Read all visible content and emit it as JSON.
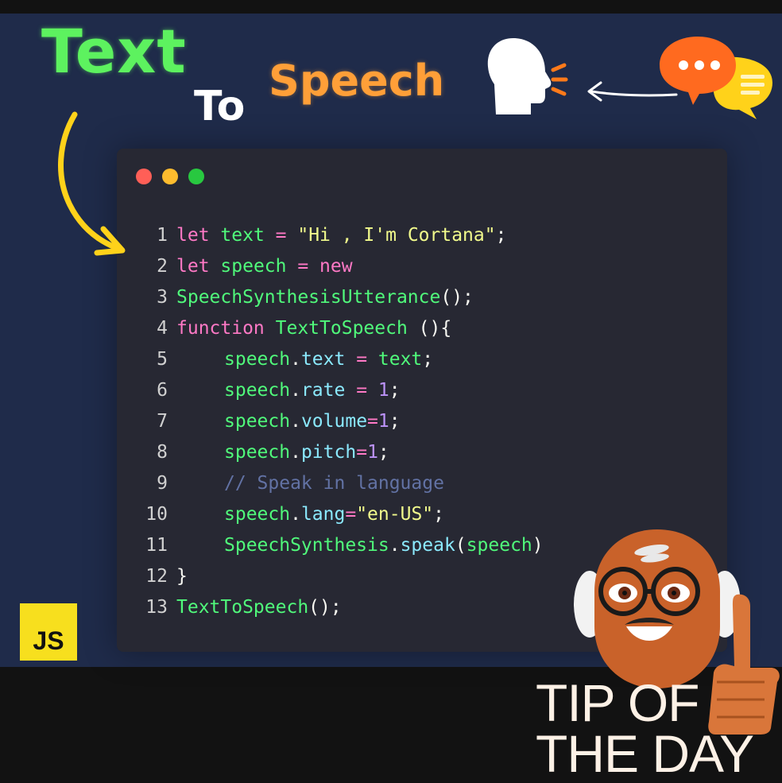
{
  "header": {
    "title_text": "Text",
    "title_to": "To",
    "title_speech": "Speech"
  },
  "icons": {
    "head": "speaking-head-icon",
    "bubbles": "speech-bubbles-icon",
    "left_arrow": "left-arrow-icon",
    "curved_arrow": "curved-arrow-icon"
  },
  "window": {
    "controls": [
      "close",
      "minimize",
      "maximize"
    ]
  },
  "code": {
    "line_numbers": [
      "1",
      "2",
      "3",
      "4",
      "5",
      "6",
      "7",
      "8",
      "9",
      "10",
      "11",
      "12",
      "13"
    ],
    "l1": {
      "kw": "let",
      "var": "text",
      "op": " = ",
      "str": "\"Hi , I'm Cortana\"",
      "end": ";"
    },
    "l2": {
      "kw": "let",
      "var": "speech",
      "op": " = ",
      "kw2": "new"
    },
    "l3": {
      "var": "SpeechSynthesisUtterance",
      "end": "();"
    },
    "l4": {
      "kw": "function",
      "var": "TextToSpeech",
      "end": " (){"
    },
    "l5": {
      "obj": "speech",
      "dot": ".",
      "prop": "text",
      "op": " = ",
      "val": "text",
      "end": ";"
    },
    "l6": {
      "obj": "speech",
      "dot": ".",
      "prop": "rate",
      "op": " = ",
      "num": "1",
      "end": ";"
    },
    "l7": {
      "obj": "speech",
      "dot": ".",
      "prop": "volume",
      "op": "=",
      "num": "1",
      "end": ";"
    },
    "l8": {
      "obj": "speech",
      "dot": ".",
      "prop": "pitch",
      "op": "=",
      "num": "1",
      "end": ";"
    },
    "l9": {
      "comment": "// Speak in language"
    },
    "l10": {
      "obj": "speech",
      "dot": ".",
      "prop": "lang",
      "op": "=",
      "str": "\"en-US\"",
      "end": ";"
    },
    "l11": {
      "obj": "SpeechSynthesis",
      "dot": ".",
      "prop": "speak",
      "p1": "(",
      "arg": "speech",
      "p2": ")"
    },
    "l12": {
      "end": "}"
    },
    "l13": {
      "var": "TextToSpeech",
      "end": "();"
    }
  },
  "badge": {
    "label": "JS"
  },
  "tip": {
    "line1": "TIP OF",
    "line2": "THE DAY"
  },
  "colors": {
    "panel": "#1f2b4a",
    "code_bg": "#272833",
    "text_green": "#5df25f",
    "speech_orange": "#ff9f38",
    "keyword": "#ff79c6",
    "identifier": "#50fa7b",
    "string": "#f1fa8c",
    "number": "#bd93f9",
    "property": "#8be9fd",
    "comment": "#6272a4"
  }
}
